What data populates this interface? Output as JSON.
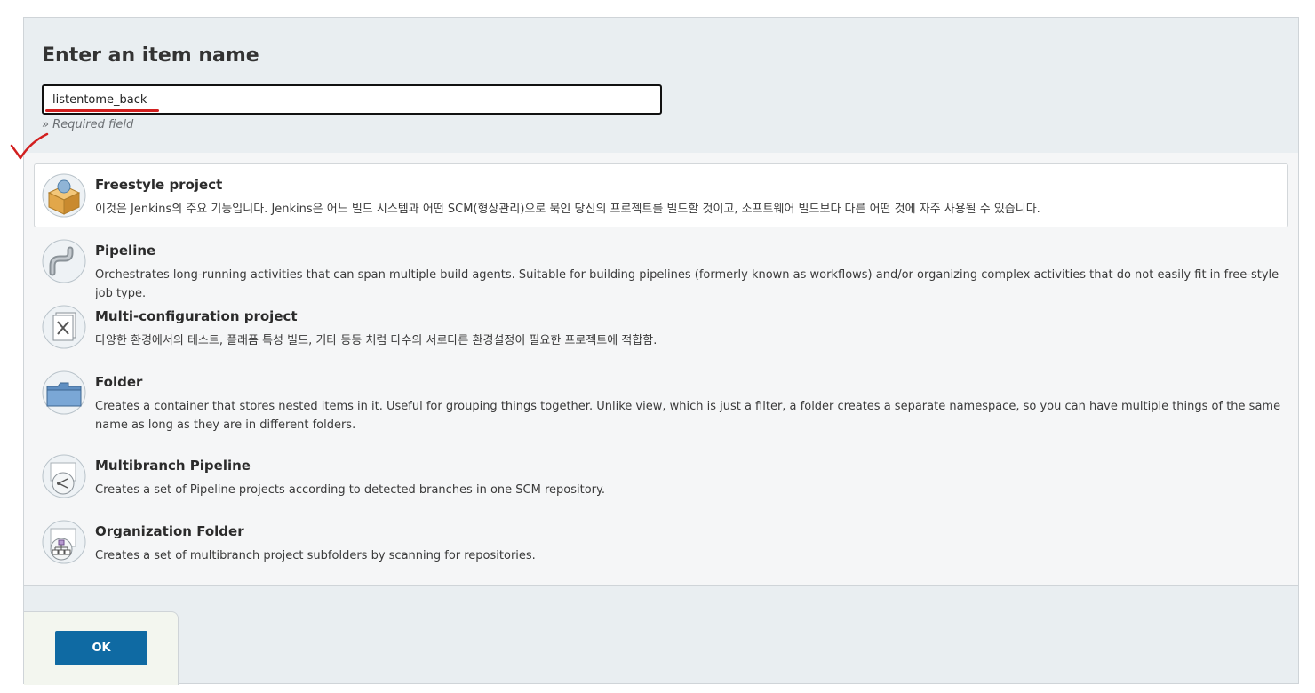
{
  "header": {
    "title": "Enter an item name",
    "item_name_value": "listentome_back",
    "required_hint": "» Required field"
  },
  "items": [
    {
      "label": "Freestyle project",
      "desc": "이것은 Jenkins의 주요 기능입니다. Jenkins은 어느 빌드 시스템과 어떤 SCM(형상관리)으로 묶인 당신의 프로젝트를 빌드할 것이고, 소프트웨어 빌드보다 다른 어떤 것에 자주 사용될 수 있습니다.",
      "icon": "freestyle-project-icon",
      "selected": true
    },
    {
      "label": "Pipeline",
      "desc": "Orchestrates long-running activities that can span multiple build agents. Suitable for building pipelines (formerly known as workflows) and/or organizing complex activities that do not easily fit in free-style job type.",
      "icon": "pipeline-icon"
    },
    {
      "label": "Multi-configuration project",
      "desc": "다양한 환경에서의 테스트, 플래폼 특성 빌드, 기타 등등 처럼 다수의 서로다른 환경설정이 필요한 프로젝트에 적합함.",
      "icon": "multi-configuration-icon"
    },
    {
      "label": "Folder",
      "desc": "Creates a container that stores nested items in it. Useful for grouping things together. Unlike view, which is just a filter, a folder creates a separate namespace, so you can have multiple things of the same name as long as they are in different folders.",
      "icon": "folder-icon"
    },
    {
      "label": "Multibranch Pipeline",
      "desc": "Creates a set of Pipeline projects according to detected branches in one SCM repository.",
      "icon": "multibranch-pipeline-icon"
    },
    {
      "label": "Organization Folder",
      "desc": "Creates a set of multibranch project subfolders by scanning for repositories.",
      "icon": "organization-folder-icon"
    }
  ],
  "footer": {
    "ok_label": "OK"
  },
  "colors": {
    "ok_button": "#0f6aa3",
    "annotation_red": "#d21f1f"
  }
}
